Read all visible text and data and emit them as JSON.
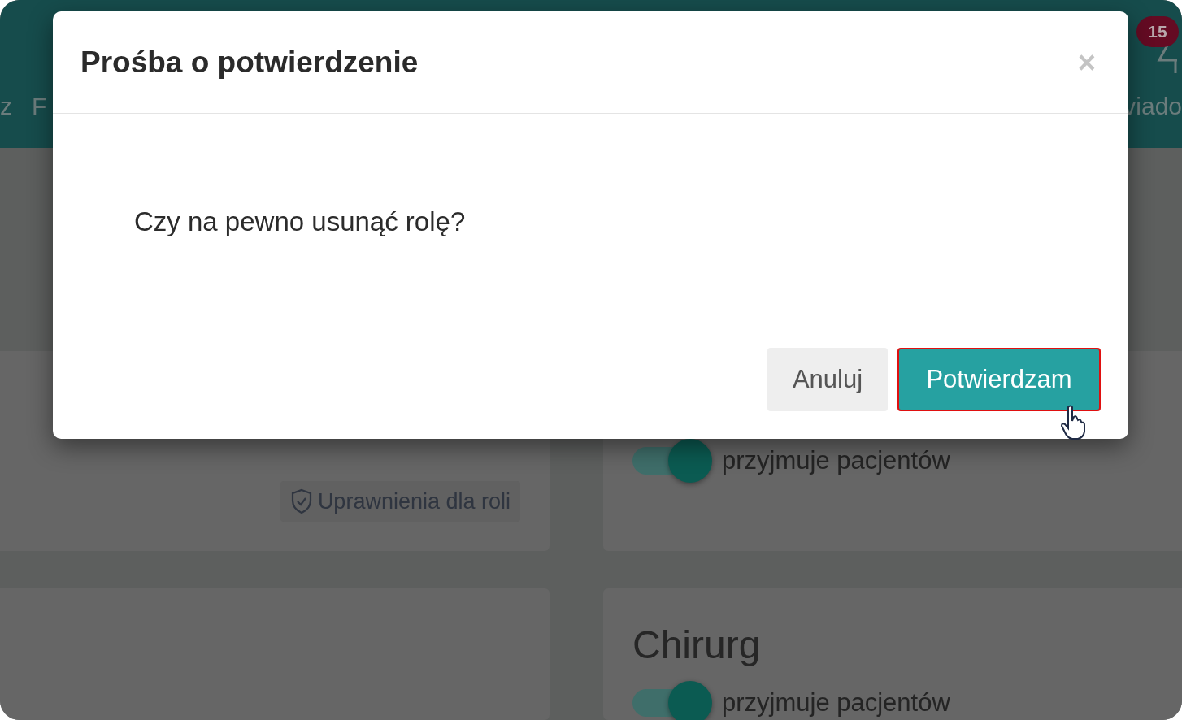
{
  "header": {
    "nav_items": [
      "z",
      "F"
    ],
    "notification_badge": "15",
    "notification_label": "viado"
  },
  "role_cards": [
    {
      "permissions_button": "Uprawnienia dla roli"
    },
    {
      "accepts_patients": {
        "label": "przyjmuje pacjentów",
        "on": true
      }
    },
    {
      "title": "Chirurg",
      "accepts_patients": {
        "label": "przyjmuje pacjentów",
        "on": true
      }
    }
  ],
  "dialog": {
    "title": "Prośba o potwierdzenie",
    "close": "×",
    "message": "Czy na pewno usunąć rolę?",
    "buttons": [
      {
        "label": "Anuluj",
        "kind": "secondary",
        "highlighted": false
      },
      {
        "label": "Potwierdzam",
        "kind": "primary",
        "highlighted": true
      }
    ]
  }
}
